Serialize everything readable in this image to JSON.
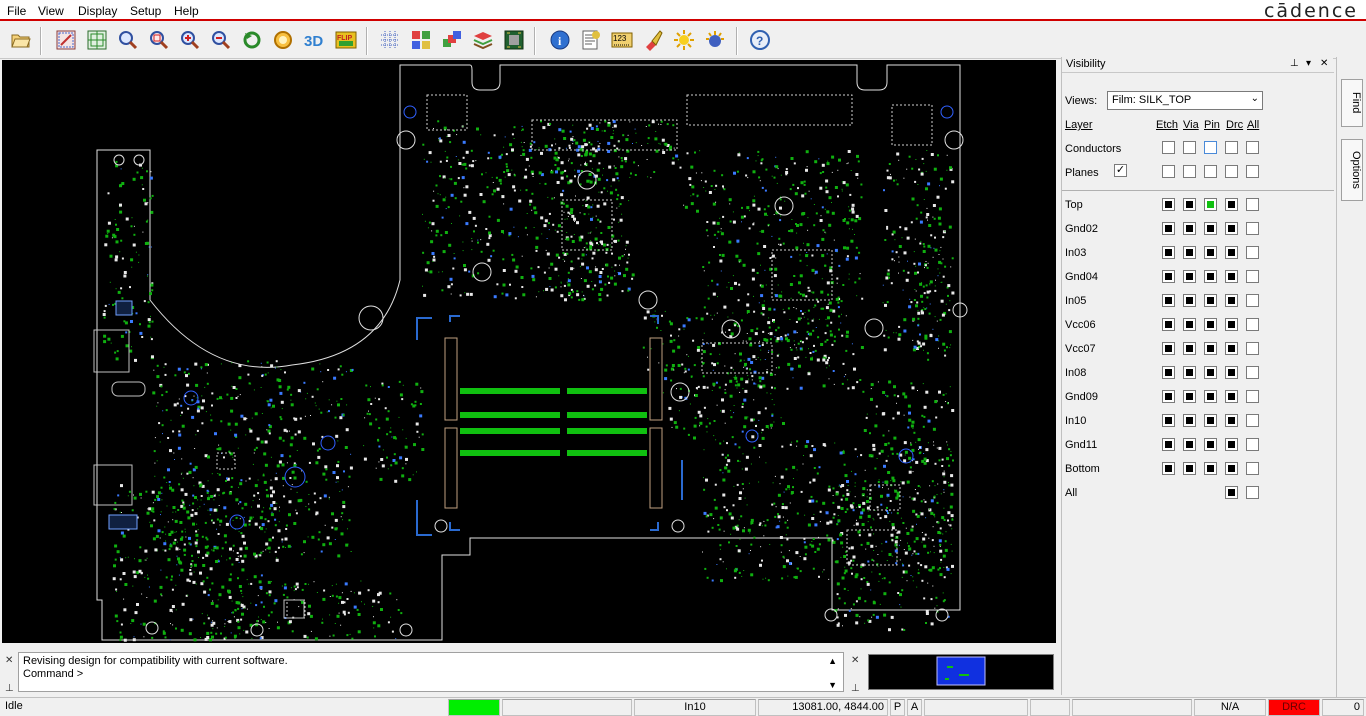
{
  "menubar": {
    "items": [
      "File",
      "View",
      "Display",
      "Setup",
      "Help"
    ],
    "brand": "cādence"
  },
  "toolbar": {
    "icons": [
      "open-icon",
      "zoom-fit-icon",
      "zoom-world-icon",
      "zoom-points-icon",
      "zoom-window-icon",
      "zoom-in-icon",
      "zoom-out-icon",
      "zoom-previous-icon",
      "redraw-icon",
      "3d-view-icon",
      "flip-icon",
      "grid-icon",
      "color-icon",
      "layer-priority-icon",
      "stack-icon",
      "board-icon",
      "info-icon",
      "report-icon",
      "measure-icon",
      "highlight-icon",
      "shadow-icon",
      "settings-icon",
      "help-icon"
    ],
    "label_3d": "3D",
    "label_flip": "FLIP",
    "label_measure": "123"
  },
  "command": {
    "line1": "Revising design for compatibility with current software.",
    "line2": "Command >"
  },
  "status": {
    "state": "Idle",
    "layer": "In10",
    "coords": "13081.00, 4844.00",
    "p_button": "P",
    "a_button": "A",
    "na": "N/A",
    "drc": "DRC",
    "count": "0"
  },
  "visibility": {
    "title": "Visibility",
    "views_label": "Views:",
    "views_value": "Film: SILK_TOP",
    "layer_header": "Layer",
    "columns": [
      "Etch",
      "Via",
      "Pin",
      "Drc",
      "All"
    ],
    "global_rows": [
      {
        "name": "Conductors",
        "check": false
      },
      {
        "name": "Planes",
        "check": true
      }
    ],
    "layers": [
      "Top",
      "Gnd02",
      "In03",
      "Gnd04",
      "In05",
      "Vcc06",
      "Vcc07",
      "In08",
      "Gnd09",
      "In10",
      "Gnd11",
      "Bottom",
      "All"
    ]
  },
  "side_tabs": [
    "Find",
    "Options"
  ],
  "colors": {
    "accent_red": "#d00000",
    "trace_green": "#00c000",
    "via_blue": "#2050ff",
    "ok_green": "#00ee00",
    "drc_red": "#ff0000"
  }
}
